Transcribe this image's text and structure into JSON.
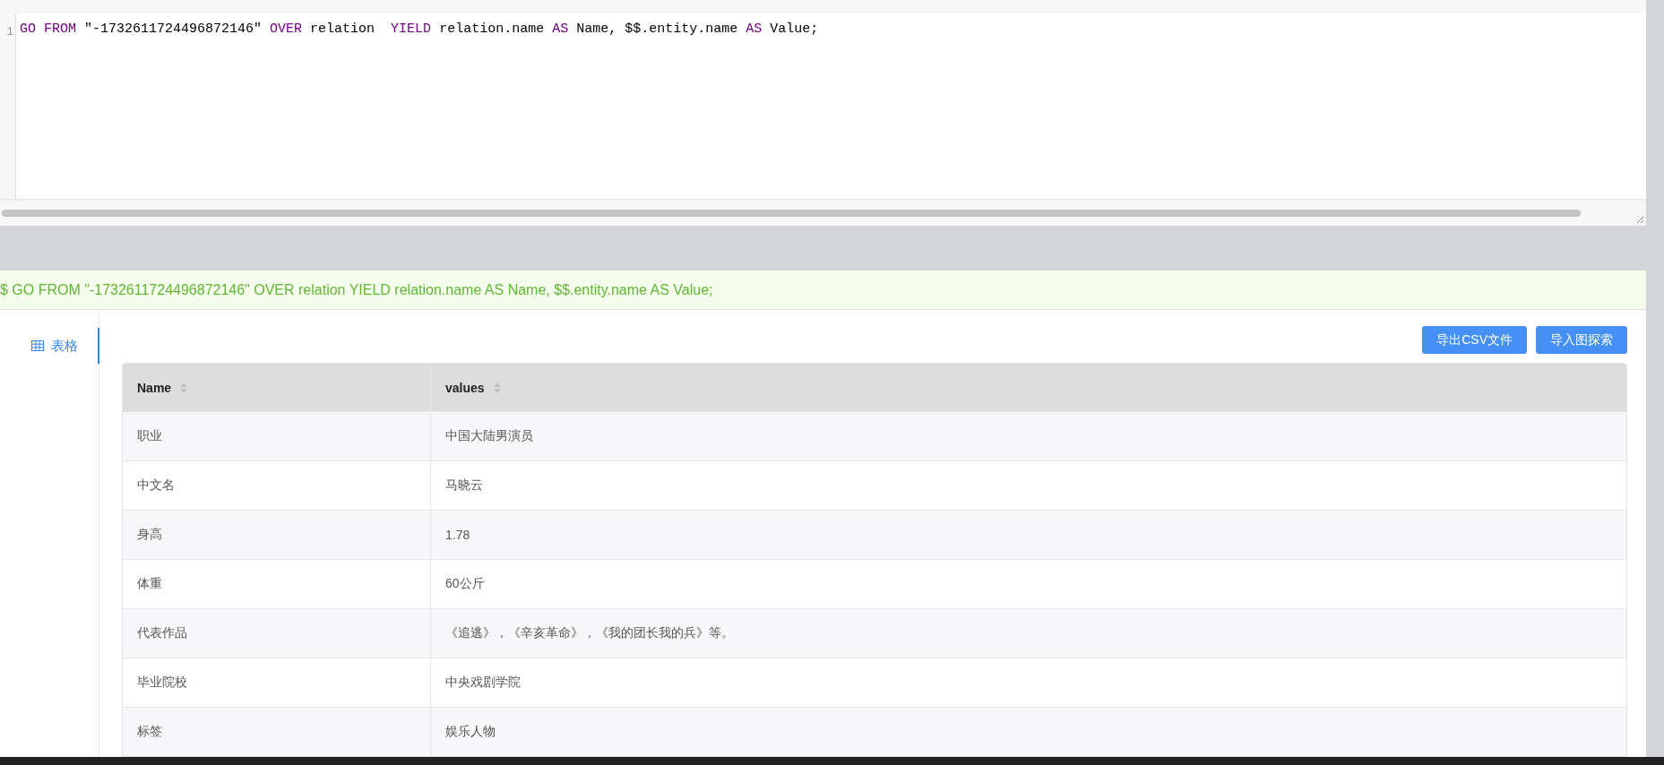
{
  "editor": {
    "line_number": "1",
    "tokens": [
      {
        "text": "GO FROM",
        "kind": "keyword"
      },
      {
        "text": " \"-1732611724496872146\" ",
        "kind": "plain"
      },
      {
        "text": "OVER",
        "kind": "keyword"
      },
      {
        "text": " relation  ",
        "kind": "plain"
      },
      {
        "text": "YIELD",
        "kind": "keyword"
      },
      {
        "text": " relation.name ",
        "kind": "plain"
      },
      {
        "text": "AS",
        "kind": "keyword"
      },
      {
        "text": " Name, $$.entity.name ",
        "kind": "plain"
      },
      {
        "text": "AS",
        "kind": "keyword"
      },
      {
        "text": " Value;",
        "kind": "plain"
      }
    ]
  },
  "query_banner": "$ GO FROM \"-1732611724496872146\" OVER relation YIELD relation.name AS Name, $$.entity.name AS Value;",
  "tabs": [
    {
      "label": "表格",
      "selected": true
    }
  ],
  "buttons": [
    "导出CSV文件",
    "导入图探索"
  ],
  "table": {
    "columns": [
      "Name",
      "values"
    ],
    "rows": [
      [
        "职业",
        "中国大陆男演员"
      ],
      [
        "中文名",
        "马晓云"
      ],
      [
        "身高",
        "1.78"
      ],
      [
        "体重",
        "60公斤"
      ],
      [
        "代表作品",
        "《追逃》，《辛亥革命》，《我的团长我的兵》等。"
      ],
      [
        "毕业院校",
        "中央戏剧学院"
      ],
      [
        "标签",
        "娱乐人物"
      ]
    ]
  }
}
